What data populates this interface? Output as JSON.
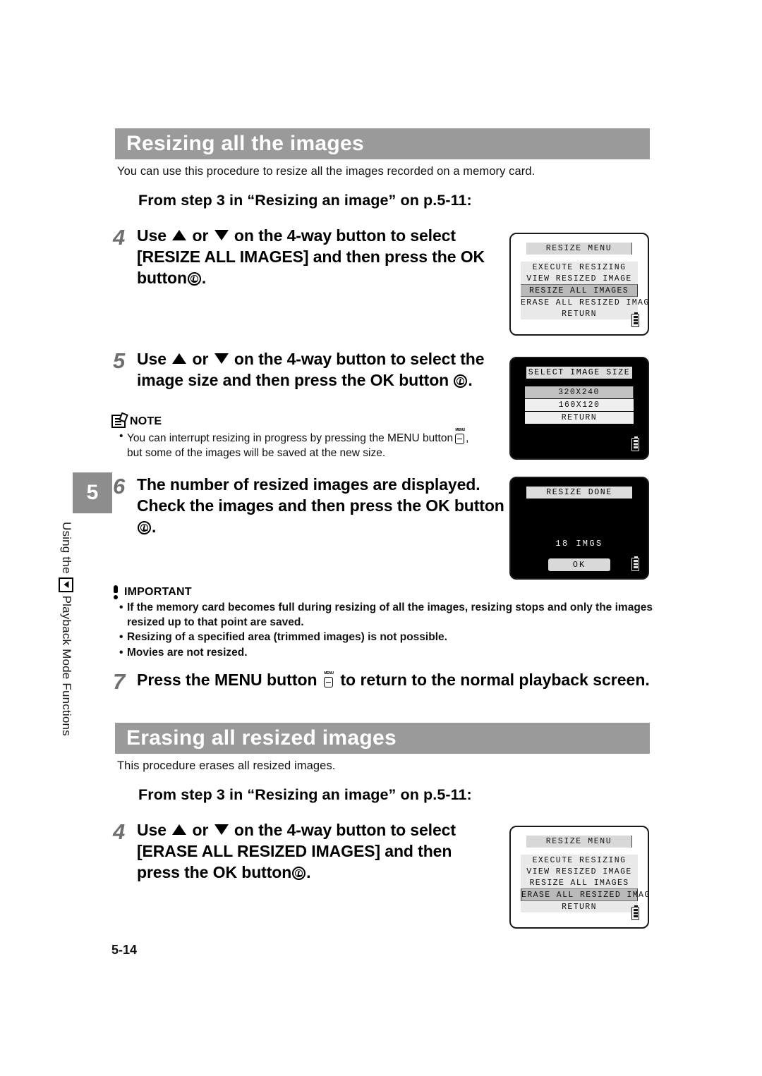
{
  "page": {
    "number": "5-14",
    "side_tab_number": "5",
    "side_tab_label_before": "Using the",
    "side_tab_label_after": "Playback Mode Functions"
  },
  "section1": {
    "heading": "Resizing all the images",
    "intro": "You can use this procedure to resize all the images recorded on a memory card.",
    "from_step": "From step 3 in “Resizing an image” on p.5-11:",
    "steps": [
      {
        "num": "4",
        "line1_a": "Use",
        "line1_b": "or",
        "line1_c": "on the 4-way button to select",
        "line2": "[RESIZE ALL IMAGES] and then press the",
        "line3_a": "OK button",
        "line3_b": "."
      },
      {
        "num": "5",
        "line1_a": "Use",
        "line1_b": "or",
        "line1_c": "on the 4-way button to select",
        "line2": "the image size and then press the OK button",
        "line3_b": "."
      },
      {
        "num": "6",
        "line1": "The number of resized images are displayed.",
        "line2": "Check the images and then press the OK",
        "line3_a": "button",
        "line3_b": "."
      },
      {
        "num": "7",
        "line1_a": "Press the MENU button",
        "line1_b": "to return to the normal playback",
        "line2": "screen."
      }
    ],
    "note": {
      "title": "NOTE",
      "bullet1_a": "You can interrupt resizing in progress by pressing the MENU button",
      "bullet1_b": ",",
      "bullet1_line2": "but some of the images will be saved at the new size."
    },
    "important": {
      "title": "IMPORTANT",
      "bullets": [
        "If the memory card becomes full during resizing of all the images, resizing stops and only the images resized up to that point are saved.",
        "Resizing of a specified area (trimmed images) is not possible.",
        "Movies are not resized."
      ]
    }
  },
  "section2": {
    "heading": "Erasing all resized images",
    "intro": "This procedure erases all resized images.",
    "from_step": "From step 3 in “Resizing an image” on p.5-11:",
    "step": {
      "num": "4",
      "line1_a": "Use",
      "line1_b": "or",
      "line1_c": "on the 4-way button to select",
      "line2": "[ERASE ALL RESIZED IMAGES] and then",
      "line3_a": "press the OK button",
      "line3_b": "."
    }
  },
  "lcd_screens": [
    {
      "id": "resize-menu-1",
      "title": "RESIZE MENU",
      "background": "white",
      "items": [
        {
          "label": "EXECUTE RESIZING",
          "selected": false
        },
        {
          "label": "VIEW RESIZED IMAGE",
          "selected": false
        },
        {
          "label": "RESIZE ALL IMAGES",
          "selected": true
        },
        {
          "label": "ERASE ALL RESIZED IMAGES",
          "selected": false
        },
        {
          "label": "RETURN",
          "selected": false
        }
      ],
      "battery": "battery-icon"
    },
    {
      "id": "select-image-size",
      "title": "SELECT IMAGE SIZE",
      "background": "black",
      "items": [
        {
          "label": "320X240",
          "selected": true
        },
        {
          "label": "160X120",
          "selected": false
        },
        {
          "label": "RETURN",
          "selected": false
        }
      ],
      "battery": "battery-icon"
    },
    {
      "id": "resize-done",
      "title": "RESIZE DONE",
      "background": "black",
      "center_text": "18  IMGS",
      "ok_label": "OK",
      "battery": "battery-icon"
    },
    {
      "id": "resize-menu-2",
      "title": "RESIZE MENU",
      "background": "white",
      "items": [
        {
          "label": "EXECUTE RESIZING",
          "selected": false
        },
        {
          "label": "VIEW RESIZED IMAGE",
          "selected": false
        },
        {
          "label": "RESIZE ALL IMAGES",
          "selected": false
        },
        {
          "label": "ERASE ALL RESIZED IMAGES",
          "selected": true
        },
        {
          "label": "RETURN",
          "selected": false
        }
      ],
      "battery": "battery-icon"
    }
  ]
}
